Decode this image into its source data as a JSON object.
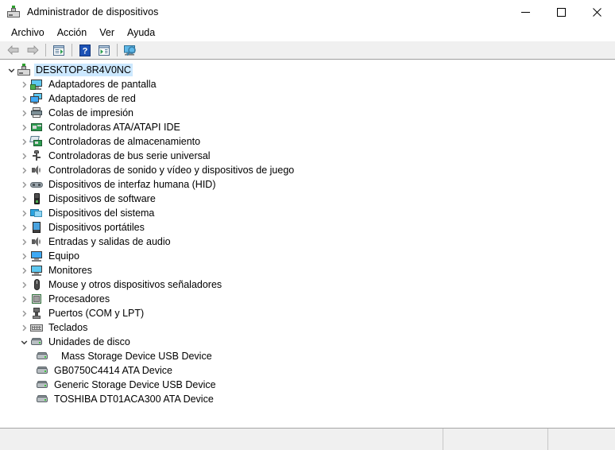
{
  "window": {
    "title": "Administrador de dispositivos",
    "icon": "device-manager-icon",
    "minimize_label": "Minimizar",
    "maximize_label": "Maximizar",
    "close_label": "Cerrar"
  },
  "menubar": {
    "items": [
      {
        "label": "Archivo",
        "name": "menu-archivo"
      },
      {
        "label": "Acción",
        "name": "menu-accion"
      },
      {
        "label": "Ver",
        "name": "menu-ver"
      },
      {
        "label": "Ayuda",
        "name": "menu-ayuda"
      }
    ]
  },
  "toolbar": {
    "buttons": [
      {
        "icon": "back-arrow-icon",
        "label": "Atrás"
      },
      {
        "icon": "forward-arrow-icon",
        "label": "Adelante"
      },
      {
        "icon": "properties-icon",
        "label": "Propiedades"
      },
      {
        "icon": "help-icon",
        "label": "Ayuda"
      },
      {
        "icon": "show-hidden-icon",
        "label": "Mostrar dispositivos ocultos"
      },
      {
        "icon": "scan-hardware-icon",
        "label": "Buscar cambios de hardware"
      }
    ]
  },
  "tree": {
    "root": {
      "label": "DESKTOP-8R4V0NC",
      "icon": "computer-node-icon",
      "expanded": true,
      "selected": true
    },
    "items": [
      {
        "label": "Adaptadores de pantalla",
        "icon": "display-adapter-icon",
        "expanded": false,
        "level": 1
      },
      {
        "label": "Adaptadores de red",
        "icon": "network-adapter-icon",
        "expanded": false,
        "level": 1
      },
      {
        "label": "Colas de impresión",
        "icon": "print-queue-icon",
        "expanded": false,
        "level": 1
      },
      {
        "label": "Controladoras ATA/ATAPI IDE",
        "icon": "ide-controller-icon",
        "expanded": false,
        "level": 1
      },
      {
        "label": "Controladoras de almacenamiento",
        "icon": "storage-controller-icon",
        "expanded": false,
        "level": 1
      },
      {
        "label": "Controladoras de bus serie universal",
        "icon": "usb-controller-icon",
        "expanded": false,
        "level": 1
      },
      {
        "label": "Controladoras de sonido y vídeo y dispositivos de juego",
        "icon": "sound-video-game-icon",
        "expanded": false,
        "level": 1
      },
      {
        "label": "Dispositivos de interfaz humana (HID)",
        "icon": "hid-device-icon",
        "expanded": false,
        "level": 1
      },
      {
        "label": "Dispositivos de software",
        "icon": "software-device-icon",
        "expanded": false,
        "level": 1
      },
      {
        "label": "Dispositivos del sistema",
        "icon": "system-device-icon",
        "expanded": false,
        "level": 1
      },
      {
        "label": "Dispositivos portátiles",
        "icon": "portable-device-icon",
        "expanded": false,
        "level": 1
      },
      {
        "label": "Entradas y salidas de audio",
        "icon": "audio-io-icon",
        "expanded": false,
        "level": 1
      },
      {
        "label": "Equipo",
        "icon": "computer-icon",
        "expanded": false,
        "level": 1
      },
      {
        "label": "Monitores",
        "icon": "monitor-icon",
        "expanded": false,
        "level": 1
      },
      {
        "label": "Mouse y otros dispositivos señaladores",
        "icon": "mouse-icon",
        "expanded": false,
        "level": 1
      },
      {
        "label": "Procesadores",
        "icon": "processor-icon",
        "expanded": false,
        "level": 1
      },
      {
        "label": "Puertos (COM y LPT)",
        "icon": "port-icon",
        "expanded": false,
        "level": 1
      },
      {
        "label": "Teclados",
        "icon": "keyboard-icon",
        "expanded": false,
        "level": 1
      },
      {
        "label": "Unidades de disco",
        "icon": "disk-drive-icon",
        "expanded": true,
        "level": 1
      },
      {
        "label": "Mass Storage Device USB Device",
        "icon": "disk-drive-icon",
        "expanded": null,
        "level": 2,
        "extra_indent": true
      },
      {
        "label": "GB0750C4414 ATA Device",
        "icon": "disk-drive-icon",
        "expanded": null,
        "level": 2,
        "extra_indent": false
      },
      {
        "label": "Generic Storage Device USB Device",
        "icon": "disk-drive-icon",
        "expanded": null,
        "level": 2,
        "extra_indent": false
      },
      {
        "label": "TOSHIBA DT01ACA300 ATA Device",
        "icon": "disk-drive-icon",
        "expanded": null,
        "level": 2,
        "extra_indent": false
      }
    ]
  },
  "statusbar": {
    "panes": [
      {
        "text": "",
        "name": "status-pane-main"
      },
      {
        "text": "",
        "name": "status-pane-secondary"
      },
      {
        "text": "",
        "name": "status-pane-tertiary"
      }
    ]
  },
  "colors": {
    "selection": "#cce8ff",
    "toolbar_bg": "#f0f0f0",
    "status_bg": "#f0f0f0",
    "text": "#000000",
    "chevron": "#9a9a9a",
    "chevron_expanded": "#3b3b3b"
  }
}
